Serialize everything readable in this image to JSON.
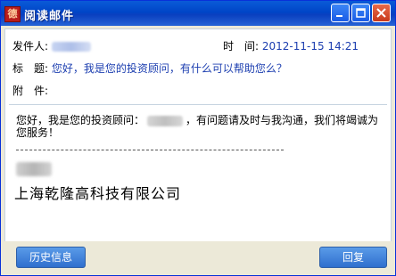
{
  "window": {
    "title": "阅读邮件",
    "app_icon_glyph": "德"
  },
  "mail": {
    "sender_label": "发件人:",
    "time_label": "时　间:",
    "time_value": "2012-11-15 14:21",
    "subject_label": "标　题:",
    "subject_value": "您好，我是您的投资顾问，有什么可以帮助您么？",
    "attachment_label": "附　件:"
  },
  "body": {
    "text_part1": "您好，我是您的投资顾问：",
    "text_part2": "，有问题请及时与我沟通，我们将竭诚为您服务！",
    "separator": "-----------------------------------------------",
    "company": "上海乾隆高科技有限公司"
  },
  "buttons": {
    "history": "历史信息",
    "reply": "回复"
  }
}
